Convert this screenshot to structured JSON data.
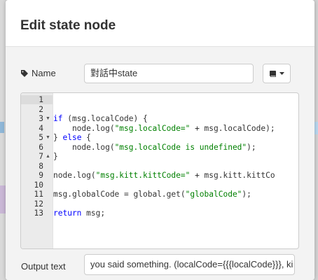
{
  "dialog": {
    "title": "Edit state node"
  },
  "form": {
    "name_label": "Name",
    "name_value": "對話中state",
    "output_label": "Output text",
    "output_value": "you said something. (localCode={{{localCode}}}, ki"
  },
  "editor": {
    "line_numbers": [
      "1",
      "2",
      "3",
      "4",
      "5",
      "6",
      "7",
      "8",
      "9",
      "10",
      "11",
      "12",
      "13"
    ],
    "lines": [
      "",
      "",
      "if (msg.localCode) {",
      "    node.log(\"msg.localCode=\" + msg.localCode);",
      "} else {",
      "    node.log(\"msg.localCode is undefined\");",
      "}",
      "",
      "node.log(\"msg.kitt.kittCode=\" + msg.kitt.kittCo",
      "",
      "msg.globalCode = global.get(\"globalCode\");",
      "",
      "return msg;"
    ]
  },
  "icons": {
    "name_icon": "tag-icon",
    "book_button_icon": "book-icon",
    "caret_icon": "caret-down-icon"
  }
}
